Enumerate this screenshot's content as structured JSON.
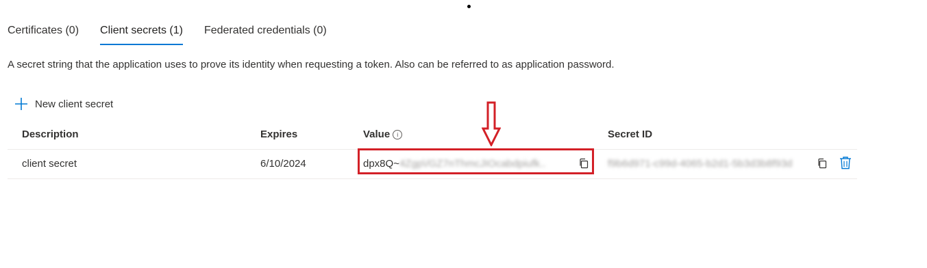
{
  "tabs": [
    {
      "label": "Certificates (0)",
      "active": false
    },
    {
      "label": "Client secrets (1)",
      "active": true
    },
    {
      "label": "Federated credentials (0)",
      "active": false
    }
  ],
  "description": "A secret string that the application uses to prove its identity when requesting a token. Also can be referred to as application password.",
  "toolbar": {
    "new_secret_label": "New client secret"
  },
  "table": {
    "columns": [
      "Description",
      "Expires",
      "Value",
      "Secret ID"
    ],
    "rows": [
      {
        "description": "client secret",
        "expires": "6/10/2024",
        "value_prefix": "dpx8Q~",
        "value_redacted": "4Zgp\\/GZ7nThmcJIOcabdpiufk..",
        "secret_id_redacted": "f9b6d971-c99d-4065-b2d1-5b3d3b8f93d"
      }
    ]
  },
  "colors": {
    "accent": "#0078d4",
    "highlight": "#d32027"
  },
  "icons": {
    "add": "plus-icon",
    "info": "info-icon",
    "copy": "copy-icon",
    "delete": "trash-icon",
    "annotation": "down-arrow-icon"
  }
}
